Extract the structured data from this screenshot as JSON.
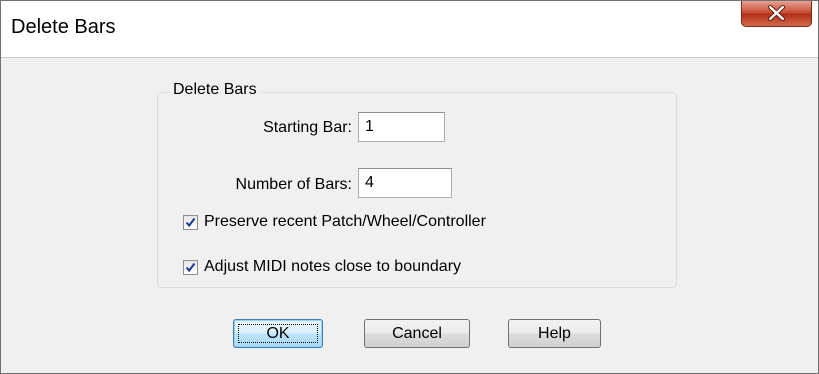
{
  "window": {
    "title": "Delete Bars"
  },
  "group": {
    "label": "Delete Bars",
    "starting_bar_label": "Starting Bar:",
    "starting_bar_value": "1",
    "number_of_bars_label": "Number of Bars:",
    "number_of_bars_value": "4",
    "preserve_label": "Preserve recent Patch/Wheel/Controller",
    "preserve_checked": true,
    "adjust_label": "Adjust MIDI notes close to boundary",
    "adjust_checked": true
  },
  "buttons": {
    "ok": "OK",
    "cancel": "Cancel",
    "help": "Help"
  },
  "colors": {
    "close_button": "#c5462c",
    "default_button_border": "#3c7fb1",
    "checkmark": "#1a3b8f"
  }
}
